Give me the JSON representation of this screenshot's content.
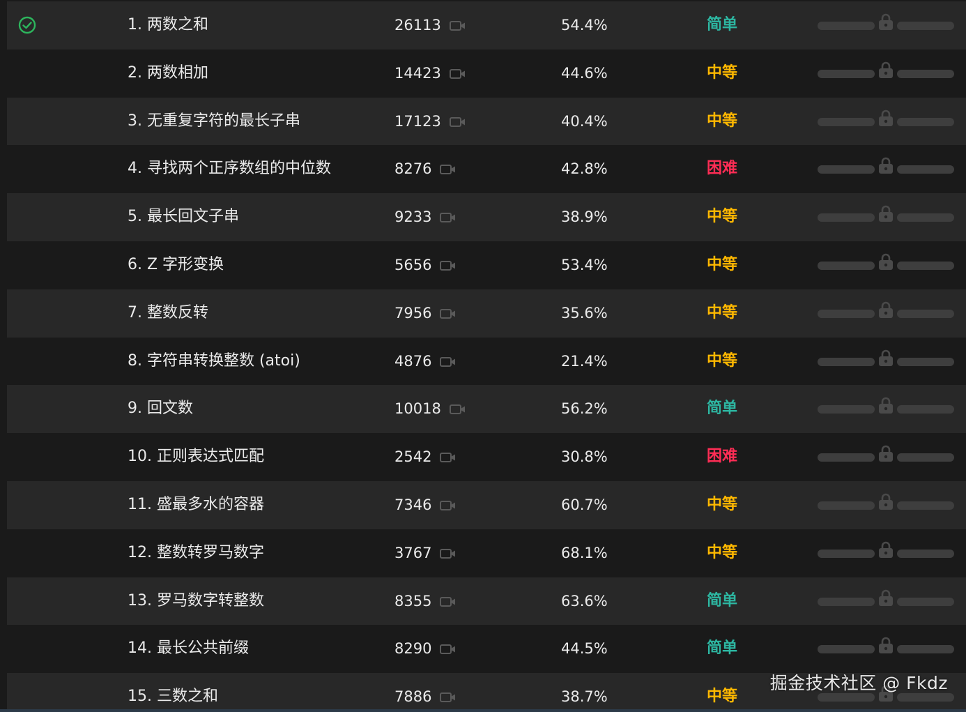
{
  "colors": {
    "easy": "#2db7a2",
    "medium": "#ffb800",
    "hard": "#ff2d55",
    "solved": "#2db55d"
  },
  "problems": [
    {
      "title": "1. 两数之和",
      "solutions": "26113",
      "acceptance": "54.4%",
      "difficulty": "简单",
      "level": "easy",
      "solved": true
    },
    {
      "title": "2. 两数相加",
      "solutions": "14423",
      "acceptance": "44.6%",
      "difficulty": "中等",
      "level": "medium",
      "solved": false
    },
    {
      "title": "3. 无重复字符的最长子串",
      "solutions": "17123",
      "acceptance": "40.4%",
      "difficulty": "中等",
      "level": "medium",
      "solved": false
    },
    {
      "title": "4. 寻找两个正序数组的中位数",
      "solutions": "8276",
      "acceptance": "42.8%",
      "difficulty": "困难",
      "level": "hard",
      "solved": false
    },
    {
      "title": "5. 最长回文子串",
      "solutions": "9233",
      "acceptance": "38.9%",
      "difficulty": "中等",
      "level": "medium",
      "solved": false
    },
    {
      "title": "6. Z 字形变换",
      "solutions": "5656",
      "acceptance": "53.4%",
      "difficulty": "中等",
      "level": "medium",
      "solved": false
    },
    {
      "title": "7. 整数反转",
      "solutions": "7956",
      "acceptance": "35.6%",
      "difficulty": "中等",
      "level": "medium",
      "solved": false
    },
    {
      "title": "8. 字符串转换整数 (atoi)",
      "solutions": "4876",
      "acceptance": "21.4%",
      "difficulty": "中等",
      "level": "medium",
      "solved": false
    },
    {
      "title": "9. 回文数",
      "solutions": "10018",
      "acceptance": "56.2%",
      "difficulty": "简单",
      "level": "easy",
      "solved": false
    },
    {
      "title": "10. 正则表达式匹配",
      "solutions": "2542",
      "acceptance": "30.8%",
      "difficulty": "困难",
      "level": "hard",
      "solved": false
    },
    {
      "title": "11. 盛最多水的容器",
      "solutions": "7346",
      "acceptance": "60.7%",
      "difficulty": "中等",
      "level": "medium",
      "solved": false
    },
    {
      "title": "12. 整数转罗马数字",
      "solutions": "3767",
      "acceptance": "68.1%",
      "difficulty": "中等",
      "level": "medium",
      "solved": false
    },
    {
      "title": "13. 罗马数字转整数",
      "solutions": "8355",
      "acceptance": "63.6%",
      "difficulty": "简单",
      "level": "easy",
      "solved": false
    },
    {
      "title": "14. 最长公共前缀",
      "solutions": "8290",
      "acceptance": "44.5%",
      "difficulty": "简单",
      "level": "easy",
      "solved": false
    },
    {
      "title": "15. 三数之和",
      "solutions": "7886",
      "acceptance": "38.7%",
      "difficulty": "中等",
      "level": "medium",
      "solved": false
    }
  ],
  "icons": {
    "solved": "check-circle-icon",
    "video": "video-icon",
    "lock": "lock-icon"
  },
  "watermark": "掘金技术社区 @ Fkdz"
}
